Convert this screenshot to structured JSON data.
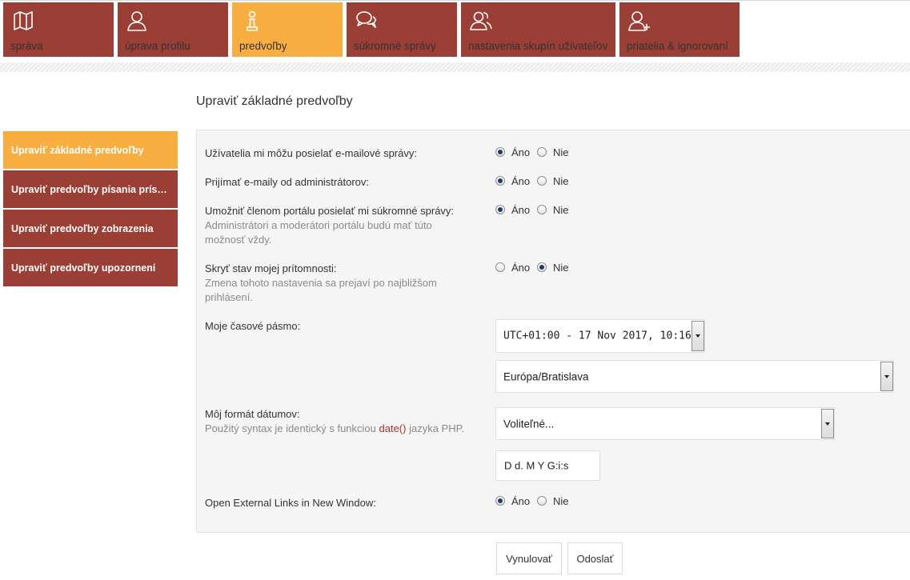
{
  "top_tabs": [
    {
      "label": "správa",
      "icon": "map-icon",
      "active": false
    },
    {
      "label": "úprava profilu",
      "icon": "user-icon",
      "active": false
    },
    {
      "label": "predvoľby",
      "icon": "chess-pawn-icon",
      "active": true
    },
    {
      "label": "súkromné správy",
      "icon": "chat-bubbles-icon",
      "active": false
    },
    {
      "label": "nastavenia skupín užívateľov",
      "icon": "users-icon",
      "active": false
    },
    {
      "label": "priatelia & ignorovaní",
      "icon": "user-add-icon",
      "active": false
    }
  ],
  "page_title": "Upraviť základné predvoľby",
  "sidebar": [
    {
      "label": "Upraviť základné predvoľby",
      "active": true
    },
    {
      "label": "Upraviť predvoľby písania príspe...",
      "active": false
    },
    {
      "label": "Upraviť predvoľby zobrazenia",
      "active": false
    },
    {
      "label": "Upraviť predvoľby upozornení",
      "active": false
    }
  ],
  "form": {
    "email_allow": {
      "label": "Užívatelia mi môžu posielať e-mailové správy:",
      "selected": "yes"
    },
    "admin_emails": {
      "label": "Prijímať e-maily od administrátorov:",
      "selected": "yes"
    },
    "pm_allow": {
      "label": "Umožniť členom portálu posielať mi súkromné správy:",
      "hint": "Administrátori a moderátori portálu budú mať túto možnosť vždy.",
      "selected": "yes"
    },
    "hide_online": {
      "label": "Skryť stav mojej prítomnosti:",
      "hint": "Zmena tohoto nastavenia sa prejaví po najbližšom prihlásení.",
      "selected": "no"
    },
    "timezone": {
      "label": "Moje časové pásmo:",
      "offset_value": "UTC+01:00 - 17 Nov 2017, 10:16",
      "zone_value": "Európa/Bratislava"
    },
    "dateformat": {
      "label": "Môj formát dátumov:",
      "hint_prefix": "Použitý syntax je identický s funkciou ",
      "hint_fn": "date()",
      "hint_suffix": " jazyka PHP.",
      "select_value": "Voliteľné...",
      "custom_value": "D d. M Y G:i:s"
    },
    "external_links": {
      "label": "Open External Links in New Window:",
      "selected": "yes"
    },
    "yes_label": "Áno",
    "no_label": "Nie"
  },
  "buttons": {
    "reset": "Vynulovať",
    "submit": "Odoslať"
  },
  "colors": {
    "tab_bg": "#9b3f36",
    "tab_active": "#f9ae42",
    "panel_bg": "#f5f5f5",
    "link_fn": "#a0342a"
  }
}
